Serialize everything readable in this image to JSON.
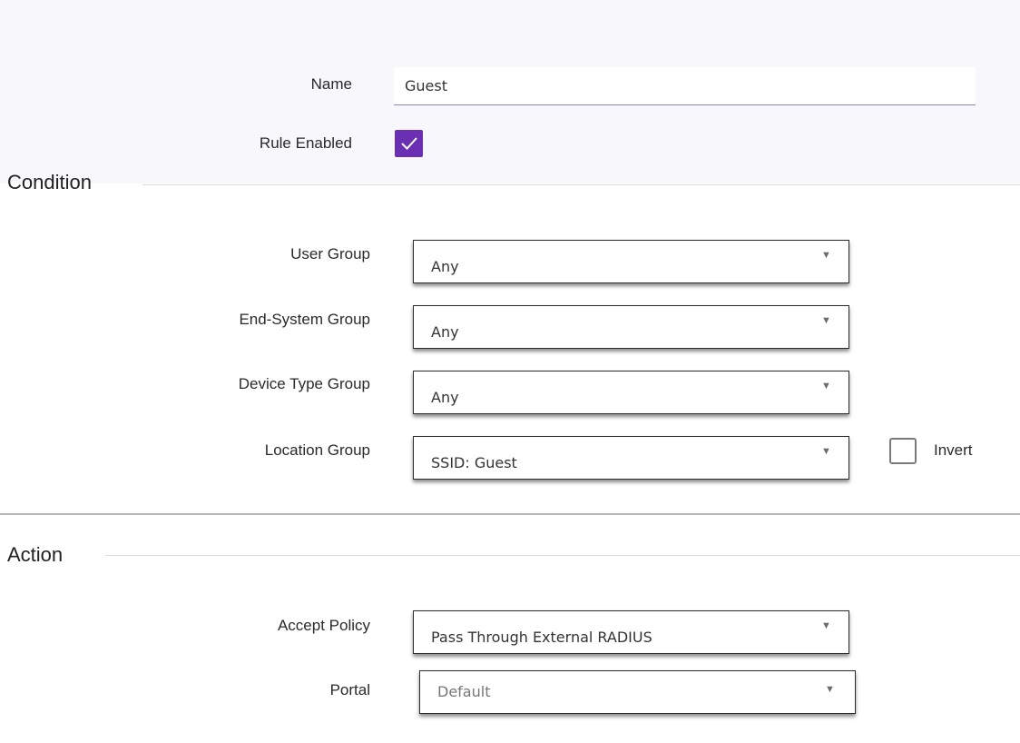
{
  "rule": {
    "name_label": "Name",
    "name_value": "Guest",
    "enabled_label": "Rule Enabled",
    "enabled_checked": true
  },
  "condition": {
    "title": "Condition",
    "user_group": {
      "label": "User Group",
      "value": "Any"
    },
    "end_system_group": {
      "label": "End-System Group",
      "value": "Any"
    },
    "device_type_group": {
      "label": "Device Type Group",
      "value": "Any"
    },
    "location_group": {
      "label": "Location Group",
      "value": "SSID: Guest"
    },
    "invert": {
      "label": "Invert",
      "checked": false
    }
  },
  "action": {
    "title": "Action",
    "accept_policy": {
      "label": "Accept Policy",
      "value": "Pass Through External RADIUS"
    },
    "portal": {
      "label": "Portal",
      "value": "Default"
    }
  },
  "icons": {
    "checkmark": "check-icon",
    "dropdown": "triangle-down-icon"
  },
  "colors": {
    "accent": "#6b2fb3",
    "panel_background": "#f7f7fc"
  }
}
